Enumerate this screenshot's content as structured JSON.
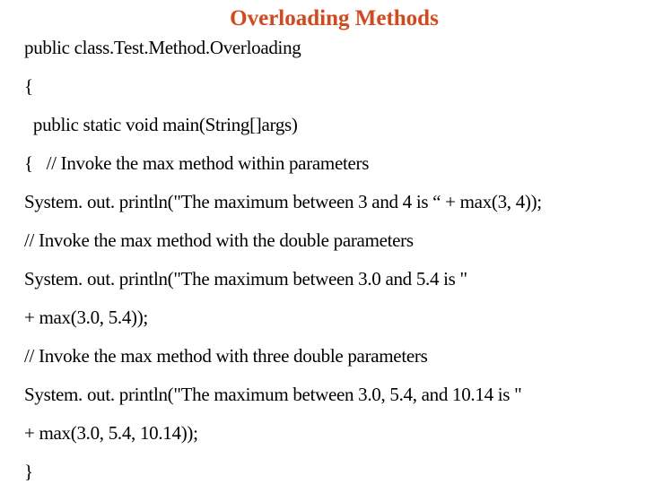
{
  "slide": {
    "title": "Overloading Methods",
    "title_color": "#d8461c",
    "lines": [
      "public class.Test.Method.Overloading",
      "{",
      "  public static void main(String[]args)",
      "{   // Invoke the max method within parameters",
      "System. out. println(\"The maximum between 3 and 4 is “ + max(3, 4));",
      "// Invoke the max method with the double parameters",
      "System. out. println(\"The maximum between 3.0 and 5.4 is \"",
      "+ max(3.0, 5.4));",
      "// Invoke the max method with three double parameters",
      "System. out. println(\"The maximum between 3.0, 5.4, and 10.14 is \"",
      "+ max(3.0, 5.4, 10.14));",
      "}"
    ]
  }
}
